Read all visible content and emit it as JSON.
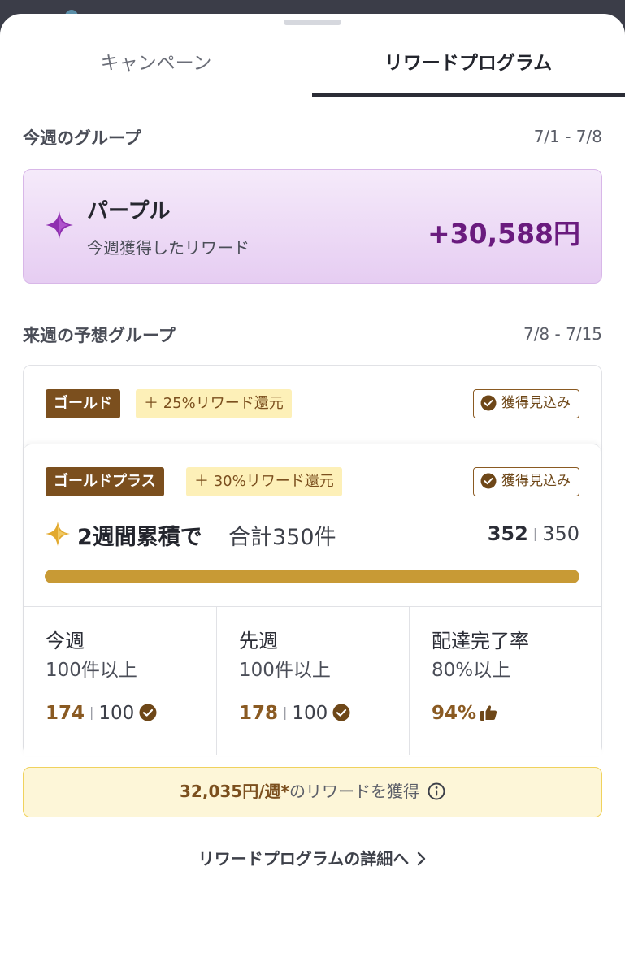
{
  "tabs": [
    {
      "label": "キャンペーン",
      "active": false
    },
    {
      "label": "リワードプログラム",
      "active": true
    }
  ],
  "this_week": {
    "section_title": "今週のグループ",
    "date_range": "7/1 - 7/8",
    "group_name": "パープル",
    "subtitle": "今週獲得したリワード",
    "amount": "+30,588円",
    "icon": "sparkle-icon",
    "accent_color": "#6a1b7e"
  },
  "next_week": {
    "section_title": "来週の予想グループ",
    "date_range": "7/8 - 7/15",
    "gold": {
      "tier_label": "ゴールド",
      "bonus_label": "＋ 25%リワード還元",
      "status_label": "獲得見込み"
    },
    "gold_plus": {
      "tier_label": "ゴールドプラス",
      "bonus_label": "＋ 30%リワード還元",
      "status_label": "獲得見込み",
      "cumulative_main": "2週間累積で",
      "cumulative_sub": "合計350件",
      "current": "352",
      "target": "350",
      "progress": 1.0,
      "stats": [
        {
          "title": "今週",
          "requirement": "100件以上",
          "value": "174",
          "target": "100",
          "icon": "check-circle-icon"
        },
        {
          "title": "先週",
          "requirement": "100件以上",
          "value": "178",
          "target": "100",
          "icon": "check-circle-icon"
        },
        {
          "title": "配達完了率",
          "requirement": "80%以上",
          "value": "94%",
          "icon": "thumbs-up-icon"
        }
      ]
    }
  },
  "reward_banner": {
    "amount": "32,035円/週*",
    "text": "のリワードを獲得",
    "icon": "info-icon"
  },
  "details_link": {
    "label": "リワードプログラムの詳細へ",
    "icon": "chevron-right-icon"
  },
  "colors": {
    "gold_dark": "#7b4f1e",
    "gold_light": "#fdf0b8",
    "progress": "#c89a35",
    "purple_bg": "#ecd8f5"
  }
}
